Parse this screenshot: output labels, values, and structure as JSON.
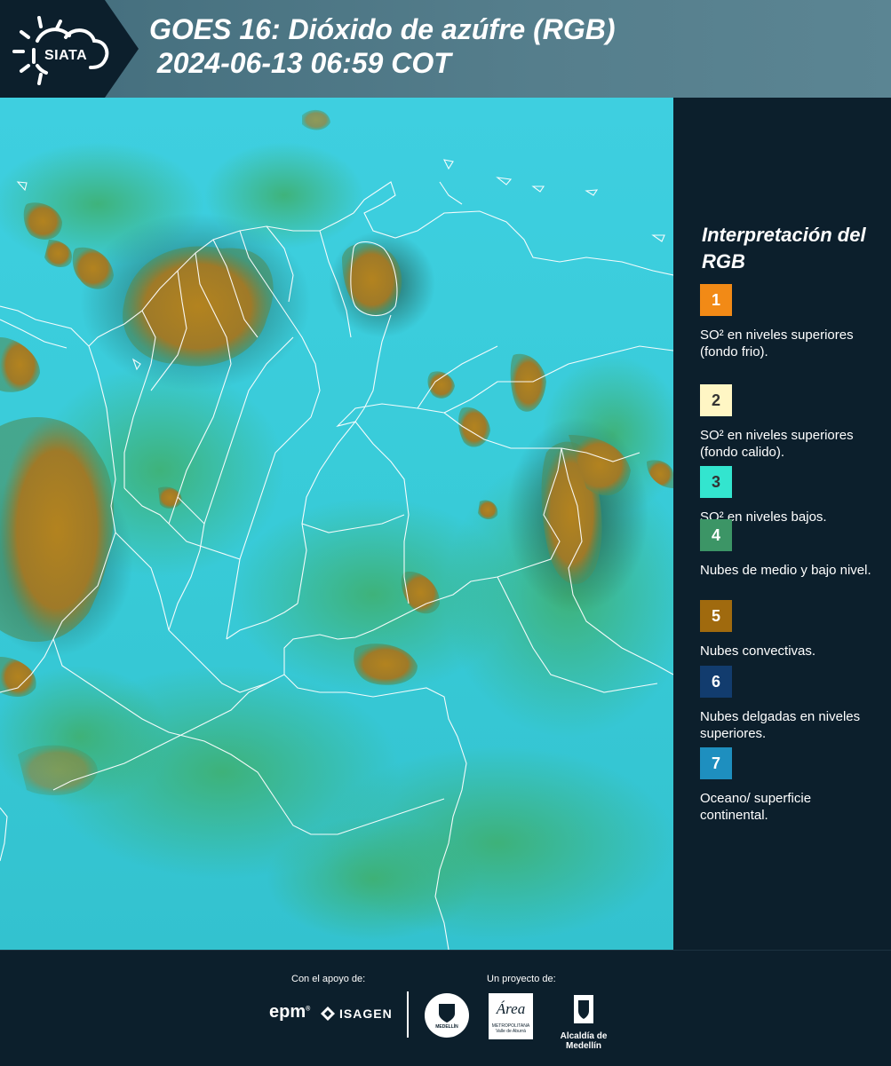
{
  "header": {
    "logo_text": "SIATA",
    "title": "GOES 16: Dióxido de azúfre (RGB)",
    "subtitle": " 2024-06-13 06:59 COT"
  },
  "map": {
    "icon": "satellite-image",
    "background_color": "#35c9d6",
    "convective_color": "#a87b1e",
    "low_cloud_color": "#3a9a6c",
    "border_color": "#ffffff"
  },
  "legend": {
    "title": "Interpretación del RGB",
    "items": [
      {
        "number": "1",
        "color": "#f28a16",
        "text_color": "#ffffff",
        "label": "SO² en niveles superiores (fondo frio)."
      },
      {
        "number": "2",
        "color": "#fff6c4",
        "text_color": "#333333",
        "label": "SO² en niveles superiores (fondo calido)."
      },
      {
        "number": "3",
        "color": "#33e5cf",
        "text_color": "#333333",
        "label": "SO² en niveles bajos."
      },
      {
        "number": "4",
        "color": "#3c9566",
        "text_color": "#ffffff",
        "label": "Nubes de medio y bajo nivel."
      },
      {
        "number": "5",
        "color": "#a06a0e",
        "text_color": "#ffffff",
        "label": "Nubes convectivas."
      },
      {
        "number": "6",
        "color": "#123c6e",
        "text_color": "#ffffff",
        "label": "Nubes delgadas en niveles superiores."
      },
      {
        "number": "7",
        "color": "#1e8fbf",
        "text_color": "#ffffff",
        "label": "Oceano/ superficie continental."
      }
    ]
  },
  "footer": {
    "support_label": "Con el apoyo de:",
    "project_label": "Un proyecto de:",
    "logo_epm": "epm",
    "logo_isagen": "ISAGEN",
    "logo_area_name": "Área",
    "logo_area_sub1": "METROPOLITANA",
    "logo_area_sub2": "Valle de Aburrá",
    "logo_alcaldia": "Alcaldía de Medellín",
    "logo_medellin_seal": "MEDELLÍN"
  }
}
